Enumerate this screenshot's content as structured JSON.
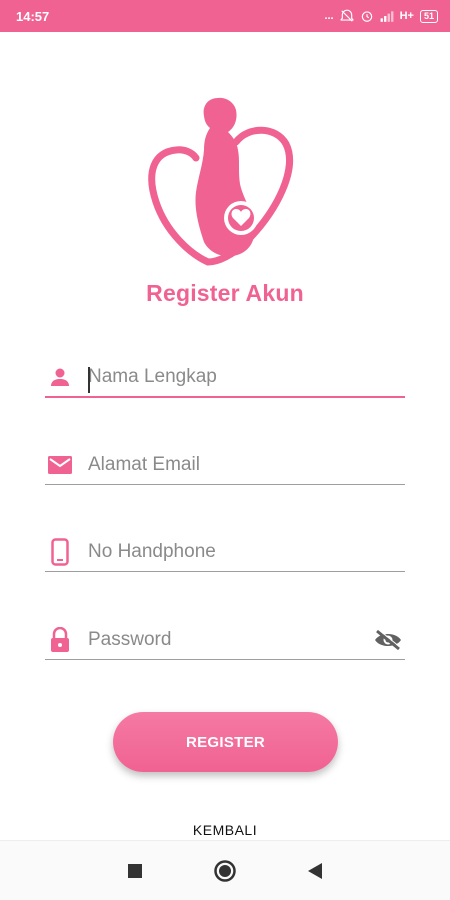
{
  "status_bar": {
    "time": "14:57",
    "dots": "...",
    "network": "H+",
    "battery": "51"
  },
  "screen": {
    "title": "Register Akun"
  },
  "form": {
    "name_placeholder": "Nama Lengkap",
    "email_placeholder": "Alamat Email",
    "phone_placeholder": "No Handphone",
    "password_placeholder": "Password"
  },
  "actions": {
    "register_label": "REGISTER",
    "back_label": "KEMBALI"
  },
  "colors": {
    "accent": "#f06292",
    "icon": "#f06292",
    "underline": "#9e9e9e",
    "text_placeholder": "#8a8a8a"
  },
  "icons": {
    "logo": "pregnant-woman-heart-logo",
    "name": "person-icon",
    "email": "mail-icon",
    "phone": "phone-icon",
    "password": "lock-icon",
    "toggle": "eye-off-icon"
  }
}
